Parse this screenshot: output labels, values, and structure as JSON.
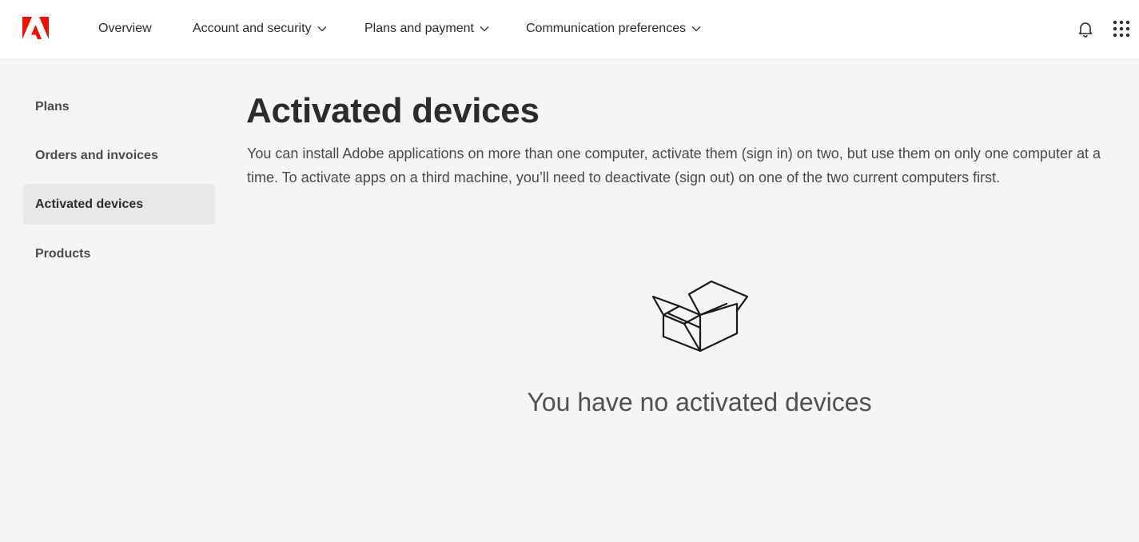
{
  "header": {
    "logo_icon": "adobe-logo-icon",
    "brand_color": "#eb1000",
    "nav": [
      {
        "label": "Overview",
        "has_dropdown": false
      },
      {
        "label": "Account and security",
        "has_dropdown": true
      },
      {
        "label": "Plans and payment",
        "has_dropdown": true
      },
      {
        "label": "Communication preferences",
        "has_dropdown": true
      }
    ],
    "notifications_icon": "bell-icon",
    "apps_icon": "app-grid-icon"
  },
  "sidebar": {
    "items": [
      {
        "label": "Plans",
        "active": false
      },
      {
        "label": "Orders and invoices",
        "active": false
      },
      {
        "label": "Activated devices",
        "active": true
      },
      {
        "label": "Products",
        "active": false
      }
    ]
  },
  "main": {
    "title": "Activated devices",
    "description": "You can install Adobe applications on more than one computer, activate them (sign in) on two, but use them on only one computer at a time. To activate apps on a third machine, you’ll need to deactivate (sign out) on one of the two current computers first.",
    "empty_state": {
      "icon": "open-box-icon",
      "message": "You have no activated devices"
    }
  }
}
